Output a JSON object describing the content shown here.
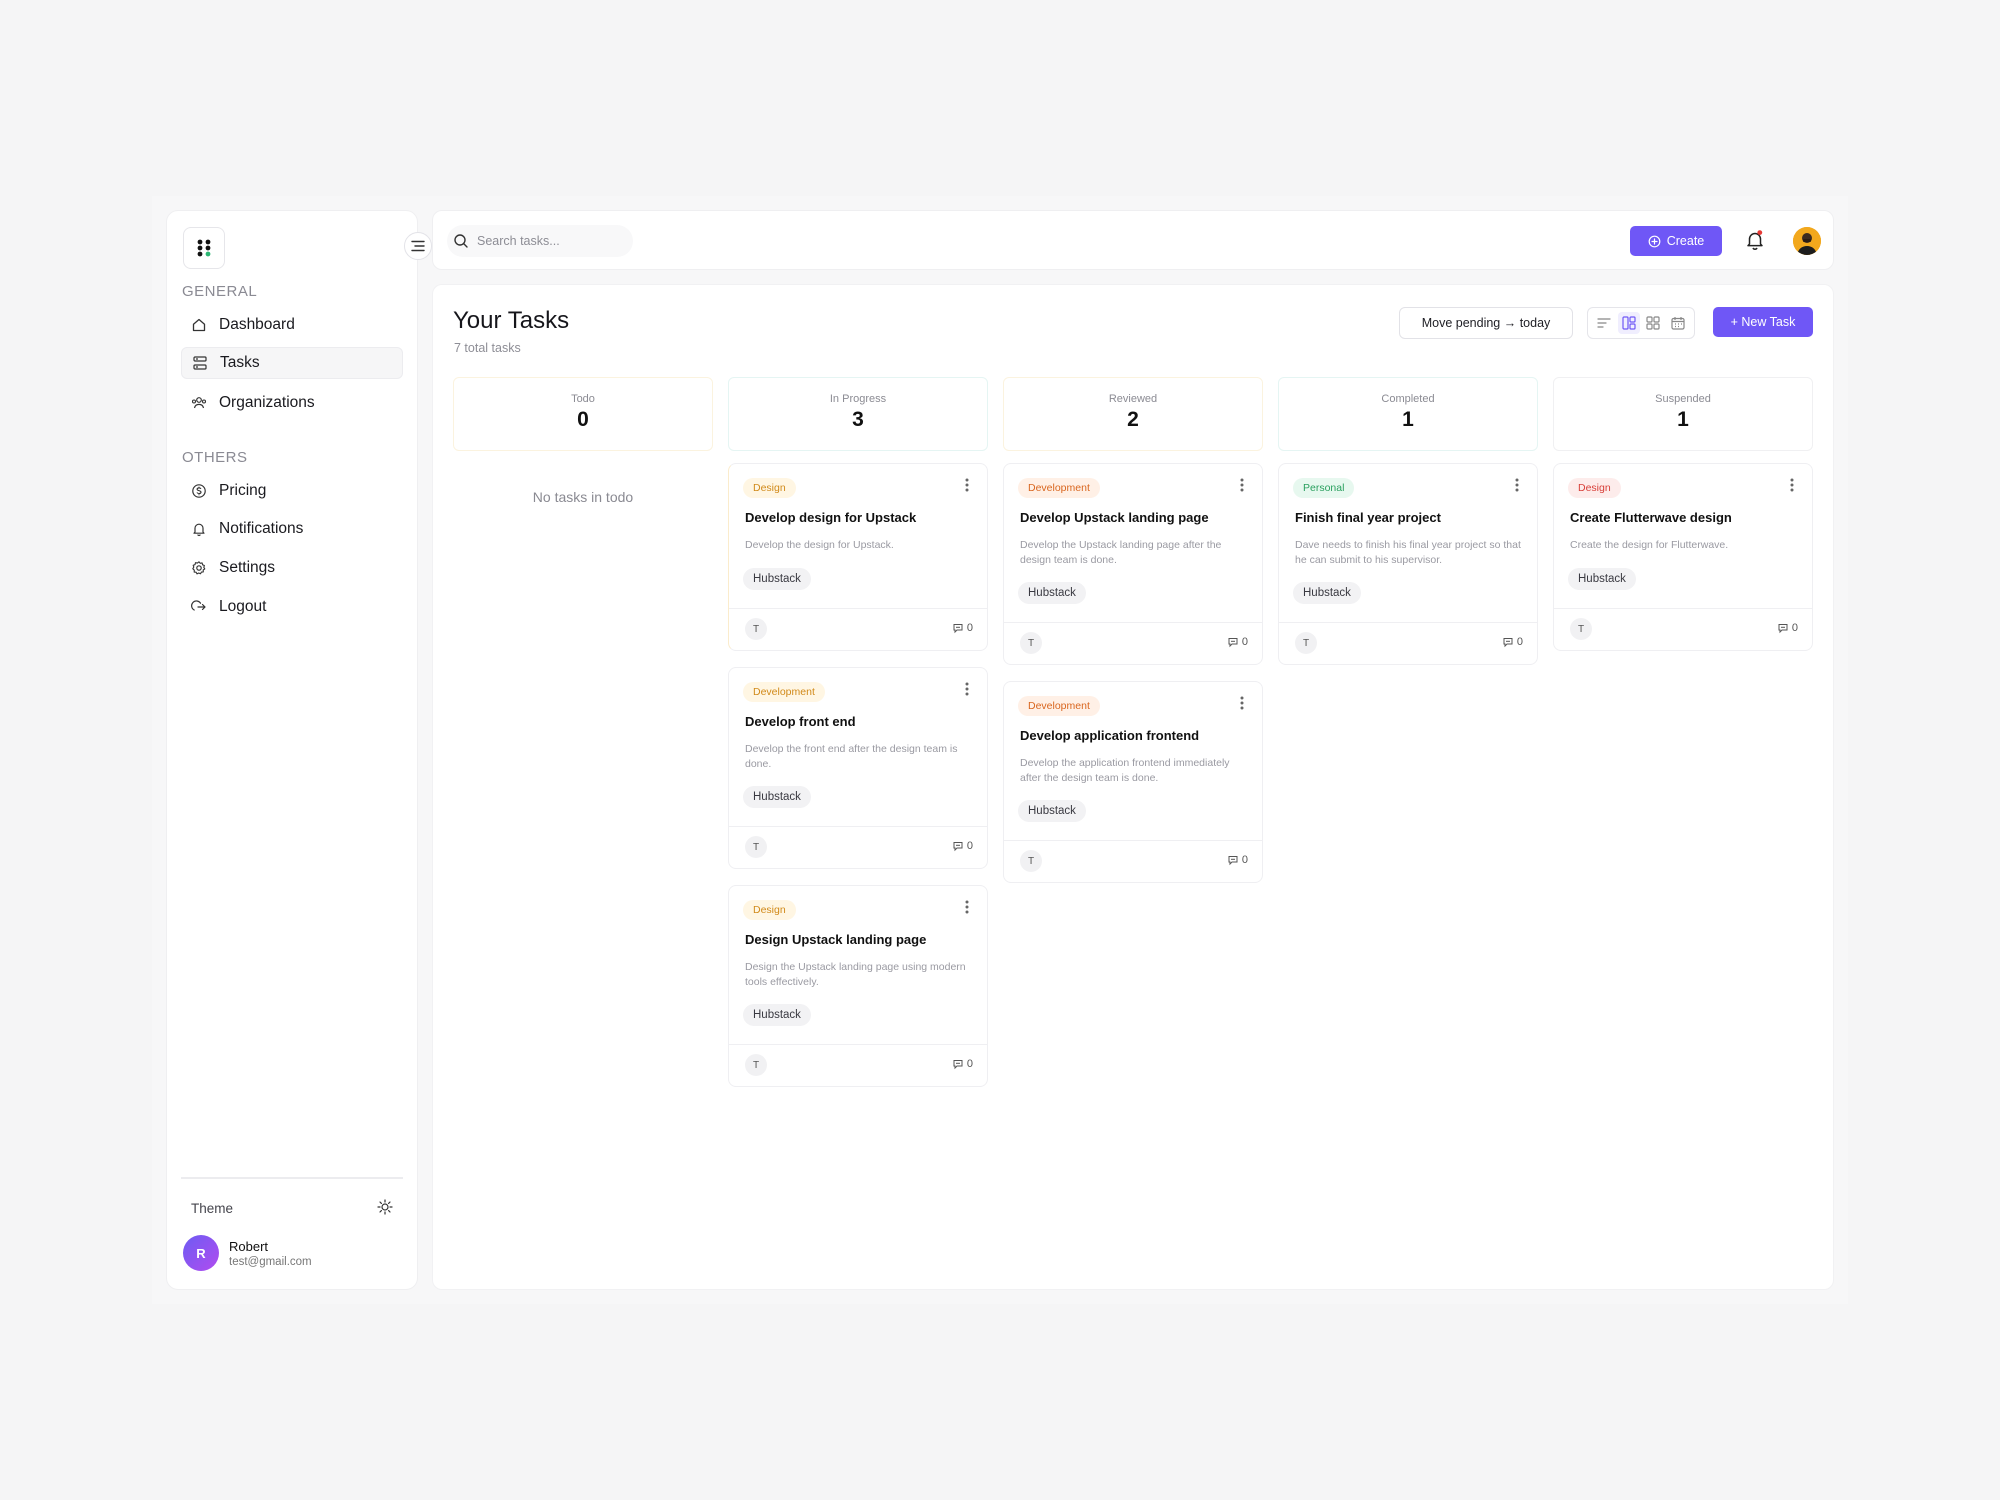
{
  "sidebar": {
    "general_label": "GENERAL",
    "others_label": "OTHERS",
    "items": [
      {
        "label": "Dashboard"
      },
      {
        "label": "Tasks"
      },
      {
        "label": "Organizations"
      },
      {
        "label": "Pricing"
      },
      {
        "label": "Notifications"
      },
      {
        "label": "Settings"
      },
      {
        "label": "Logout"
      }
    ],
    "theme_label": "Theme",
    "user": {
      "initial": "R",
      "name": "Robert",
      "email": "test@gmail.com"
    }
  },
  "topbar": {
    "search_placeholder": "Search tasks...",
    "create_label": "Create"
  },
  "main": {
    "title": "Your Tasks",
    "subtitle": "7 total tasks",
    "move_pending_label": "Move pending → today",
    "new_task_label": "+ New Task"
  },
  "columns": [
    {
      "name": "Todo",
      "count": "0",
      "empty_text": "No tasks in todo"
    },
    {
      "name": "In Progress",
      "count": "3"
    },
    {
      "name": "Reviewed",
      "count": "2"
    },
    {
      "name": "Completed",
      "count": "1"
    },
    {
      "name": "Suspended",
      "count": "1"
    }
  ],
  "cards": {
    "inprogress": [
      {
        "tag": "Design",
        "title": "Develop design for Upstack",
        "desc": "Develop the design for Upstack.",
        "org": "Hubstack",
        "assignee": "T",
        "comments": "0"
      },
      {
        "tag": "Development",
        "title": "Develop front end",
        "desc": "Develop the front end after the design team is done.",
        "org": "Hubstack",
        "assignee": "T",
        "comments": "0"
      },
      {
        "tag": "Design",
        "title": "Design Upstack landing page",
        "desc": "Design the Upstack landing page using modern tools effectively.",
        "org": "Hubstack",
        "assignee": "T",
        "comments": "0"
      }
    ],
    "reviewed": [
      {
        "tag": "Development",
        "title": "Develop Upstack landing page",
        "desc": "Develop the Upstack landing page after the design team is done.",
        "org": "Hubstack",
        "assignee": "T",
        "comments": "0"
      },
      {
        "tag": "Development",
        "title": "Develop application frontend",
        "desc": "Develop the application frontend immediately after the design team is done.",
        "org": "Hubstack",
        "assignee": "T",
        "comments": "0"
      }
    ],
    "completed": [
      {
        "tag": "Personal",
        "title": "Finish final year project",
        "desc": "Dave needs to finish his final year project so that he can submit to his supervisor.",
        "org": "Hubstack",
        "assignee": "T",
        "comments": "0"
      }
    ],
    "suspended": [
      {
        "tag": "Design",
        "title": "Create Flutterwave design",
        "desc": "Create the design for Flutterwave.",
        "org": "Hubstack",
        "assignee": "T",
        "comments": "0"
      }
    ]
  },
  "colors": {
    "accent": "#6f57f6",
    "tag_design_yellow": "#d18a1a",
    "tag_development": "#d9661f",
    "tag_personal": "#2aa05f",
    "tag_design_red": "#d8403a"
  }
}
